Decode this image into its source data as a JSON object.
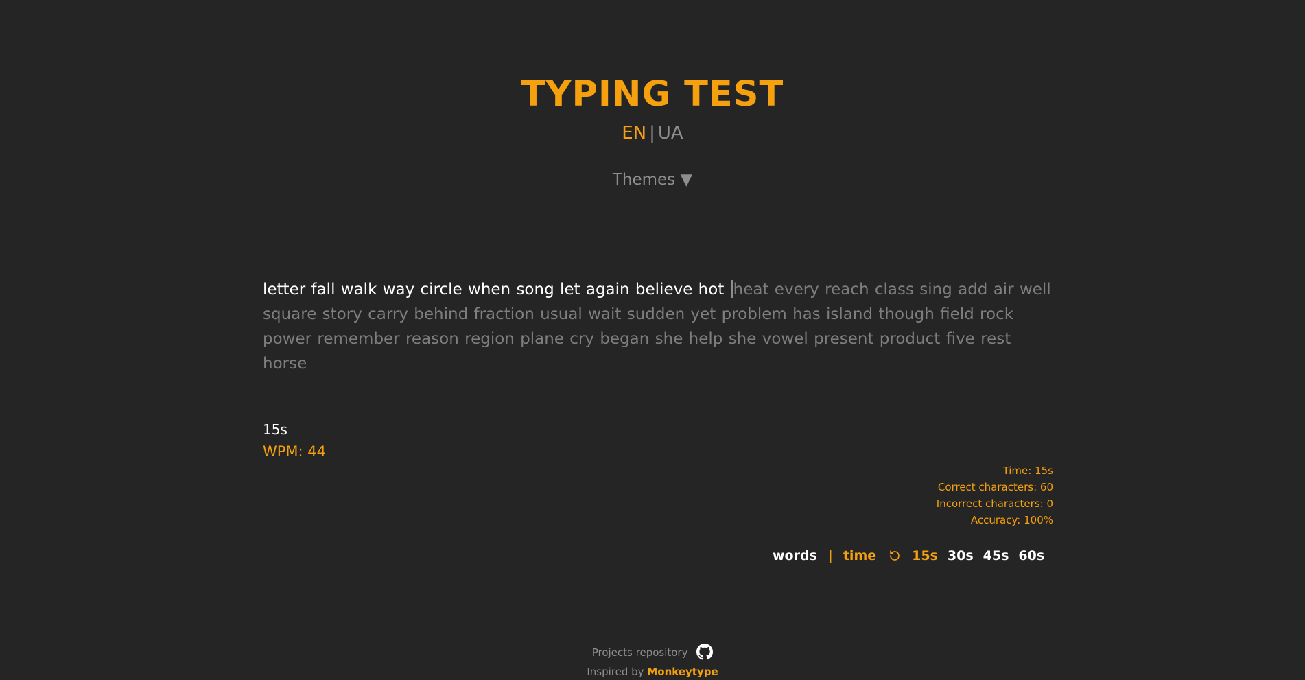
{
  "header": {
    "title": "TYPING TEST",
    "languages": {
      "active": "EN",
      "separator": "|",
      "inactive": "UA"
    },
    "themes_label": "Themes ▼"
  },
  "test": {
    "typed_text": "letter fall walk way circle when song let again believe hot",
    "remaining_text": "heat every reach class sing add air well square story carry behind fraction usual wait sudden yet problem has island though field rock power remember reason region plane cry began she help she vowel present product five rest horse"
  },
  "live": {
    "timer": "15s",
    "wpm": "WPM: 44"
  },
  "results": {
    "time": "Time: 15s",
    "correct": "Correct characters: 60",
    "incorrect": "Incorrect characters: 0",
    "accuracy": "Accuracy: 100%"
  },
  "mode_bar": {
    "words_label": "words",
    "separator": "|",
    "time_label": "time",
    "reset_icon": "reset-icon",
    "durations": [
      "15s",
      "30s",
      "45s",
      "60s"
    ],
    "active_duration": "15s"
  },
  "footer": {
    "repo_label": "Projects repository",
    "repo_icon": "github-icon",
    "inspired_prefix": "Inspired by",
    "inspired_link": "Monkeytype"
  },
  "colors": {
    "background": "#252525",
    "accent": "#f5a00e",
    "typed": "#ffffff",
    "untyped": "#7e7e7e"
  }
}
